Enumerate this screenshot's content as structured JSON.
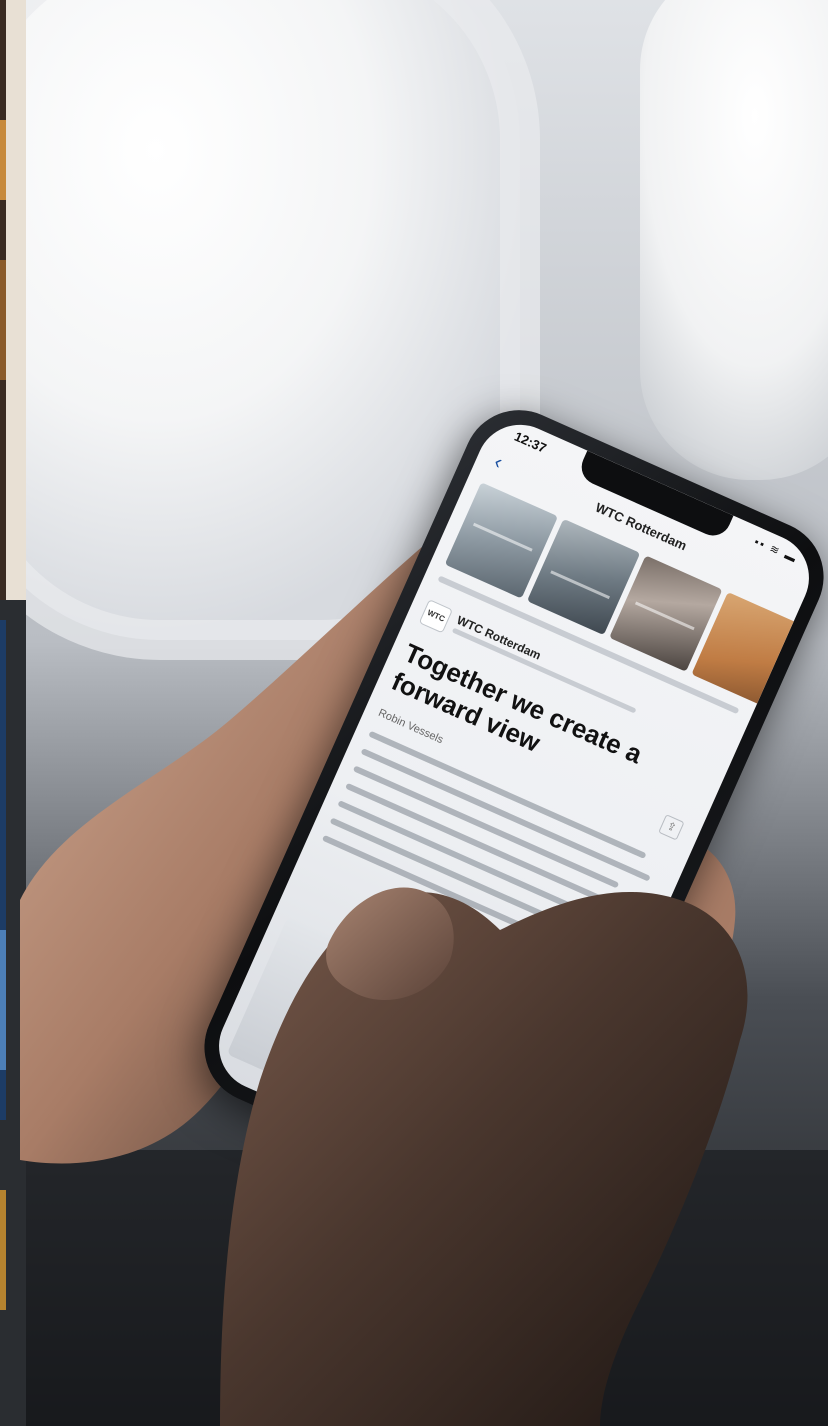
{
  "photo": {
    "subject": "person-holding-smartphone-in-airplane-cabin",
    "colors": {
      "window_glow": "#fbfbfb",
      "cabin_wall": "#c9ccd1",
      "cabin_shadow": "#2a2d31",
      "skin_light": "#c79f88",
      "skin_dark": "#3b2c25",
      "phone_frame": "#0d0e10",
      "link_blue": "#1a4fa0"
    }
  },
  "phone_screen": {
    "status_bar": {
      "time": "12:37",
      "icons": "▪▪ ≋ ▬"
    },
    "nav": {
      "back_icon": "chevron-left-icon",
      "title": "WTC Rotterdam"
    },
    "source": {
      "logo_text": "WTC",
      "name": "WTC Rotterdam"
    },
    "article": {
      "headline": "Together we create a forward view",
      "subtitle": "Robin Vessels"
    },
    "share_icon": "share-icon"
  }
}
